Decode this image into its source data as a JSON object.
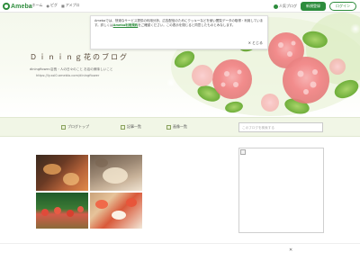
{
  "header": {
    "logo_text": "Ameba",
    "nav": [
      {
        "icon": "home-icon",
        "label": "ホーム"
      },
      {
        "icon": "pig-icon",
        "label": "ピグ"
      },
      {
        "icon": "app-icon",
        "label": "アメプロ"
      }
    ],
    "person_blog_label": "人気ブログ",
    "register_label": "新規登録",
    "login_label": "ログイン"
  },
  "notice": {
    "text_before": "Amebaでは、快適なサービス提供の利用分析、広告配信のためにクッキーなどを使い閲覧データの取得・利用しています。詳しくは",
    "link_text": "Ameba利用規約",
    "text_after": "をご確認ください。この表示を閉じると同意したものとみなします。",
    "close_label": "とじる"
  },
  "blog": {
    "title": "Ｄｉｎｉｎｇ花のブログ",
    "description": "diningfiower.店長・人の日々のこと お店の美味しいこと",
    "url": "https://ly.ssl0.ameblo.com/diningfiower"
  },
  "navbar": {
    "items": [
      {
        "label": "ブログトップ"
      },
      {
        "label": "記事一覧"
      },
      {
        "label": "画像一覧"
      }
    ],
    "search_placeholder": "このブログを検索する"
  },
  "bottom": {
    "close_symbol": "✕"
  },
  "colors": {
    "brand_green": "#2d8c3c",
    "nav_bg": "#f1f6e6"
  }
}
